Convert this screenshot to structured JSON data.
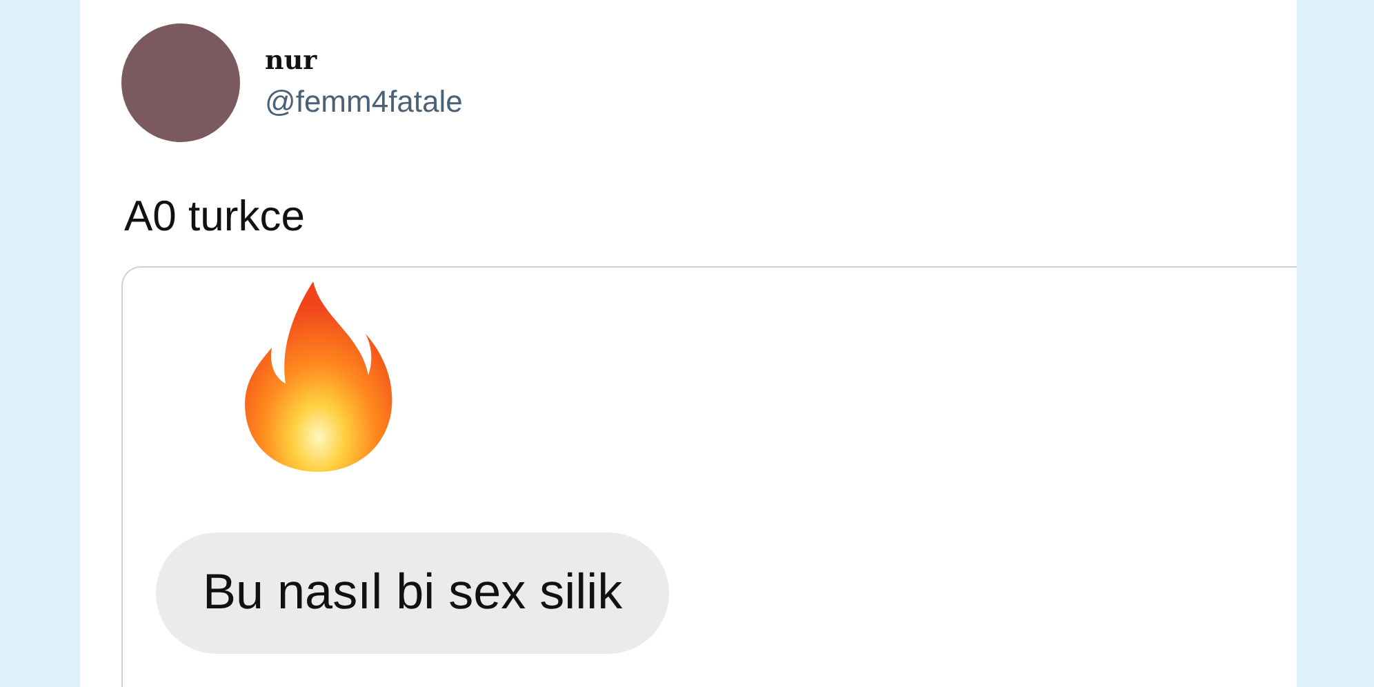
{
  "tweet": {
    "author_name": "nur",
    "handle": "@femm4fatale",
    "text": "A0 turkce",
    "quoted_message": {
      "text": "Bu nasıl bi sex silik"
    }
  }
}
